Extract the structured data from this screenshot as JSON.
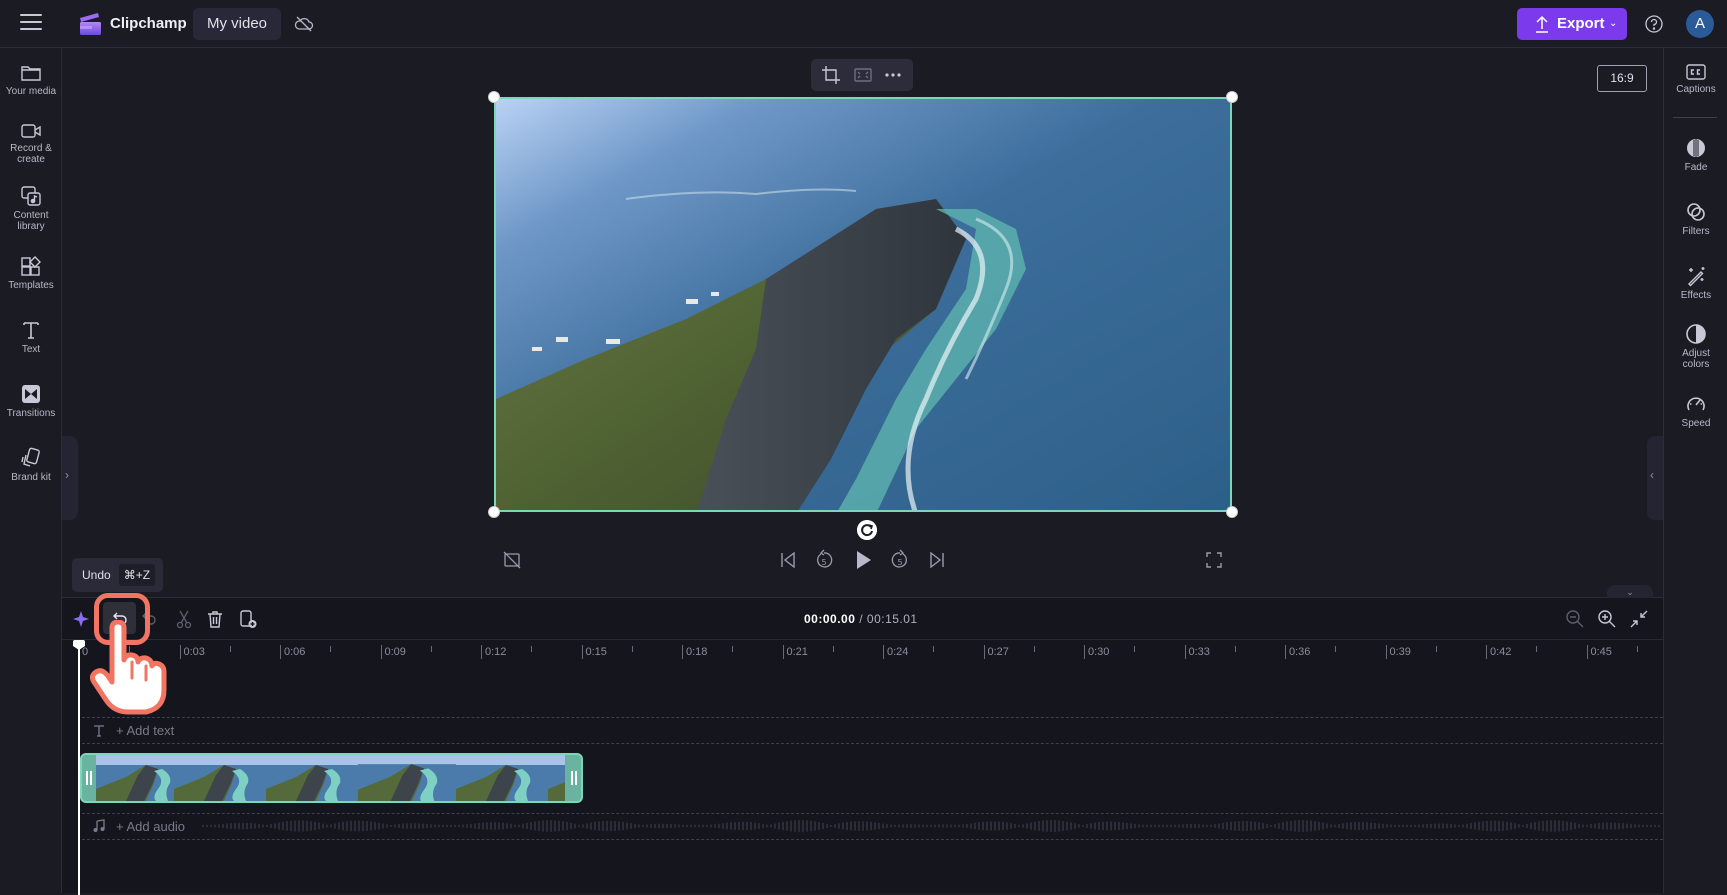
{
  "app": {
    "brand": "Clipchamp",
    "project_name": "My video",
    "export_label": "Export",
    "avatar_initial": "A"
  },
  "left_rail": [
    {
      "label_line1": "Your media",
      "label_line2": "",
      "icon": "folder-icon"
    },
    {
      "label_line1": "Record &",
      "label_line2": "create",
      "icon": "video-camera-icon"
    },
    {
      "label_line1": "Content",
      "label_line2": "library",
      "icon": "content-library-icon"
    },
    {
      "label_line1": "Templates",
      "label_line2": "",
      "icon": "templates-icon"
    },
    {
      "label_line1": "Text",
      "label_line2": "",
      "icon": "text-icon"
    },
    {
      "label_line1": "Transitions",
      "label_line2": "",
      "icon": "transitions-icon"
    },
    {
      "label_line1": "Brand kit",
      "label_line2": "",
      "icon": "brand-kit-icon"
    }
  ],
  "right_rail": [
    {
      "label_line1": "Captions",
      "label_line2": "",
      "icon": "captions-icon"
    },
    {
      "label_line1": "Fade",
      "label_line2": "",
      "icon": "fade-icon"
    },
    {
      "label_line1": "Filters",
      "label_line2": "",
      "icon": "filters-icon"
    },
    {
      "label_line1": "Effects",
      "label_line2": "",
      "icon": "effects-wand-icon"
    },
    {
      "label_line1": "Adjust",
      "label_line2": "colors",
      "icon": "adjust-colors-icon"
    },
    {
      "label_line1": "Speed",
      "label_line2": "",
      "icon": "speed-gauge-icon"
    }
  ],
  "preview": {
    "aspect_ratio": "16:9"
  },
  "tooltip": {
    "label": "Undo",
    "shortcut": "⌘+Z"
  },
  "timeline": {
    "current_time": "00:00.00",
    "separator": " / ",
    "total_time": "00:15.01",
    "ruler_ticks": [
      "0",
      "0:03",
      "0:06",
      "0:09",
      "0:12",
      "0:15",
      "0:18",
      "0:21",
      "0:24",
      "0:27",
      "0:30",
      "0:33",
      "0:36",
      "0:39",
      "0:42",
      "0:45"
    ],
    "add_text_label": "+ Add text",
    "add_audio_label": "+ Add audio"
  },
  "colors": {
    "accent": "#7c3aed",
    "selection": "#7ad7b7",
    "highlight": "#f27462"
  }
}
